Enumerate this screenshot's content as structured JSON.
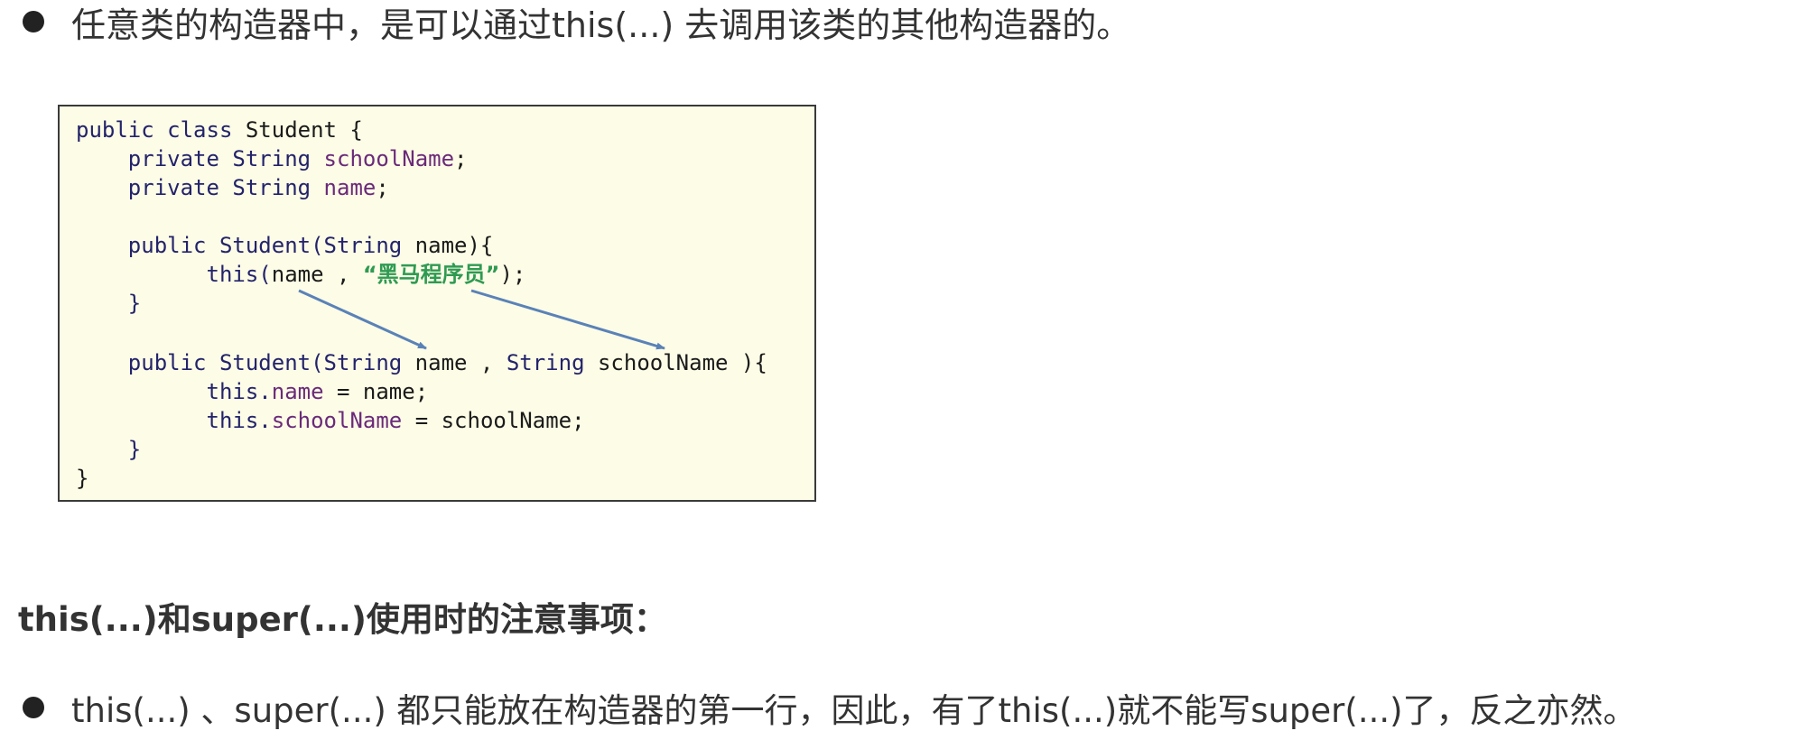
{
  "bullet1": {
    "text": "任意类的构造器中，是可以通过this(...) 去调用该类的其他构造器的。"
  },
  "code": {
    "line1": {
      "kw1": "public class",
      "rest": " Student {"
    },
    "line2": {
      "indent": "    ",
      "kw": "private String",
      "sp": " ",
      "field": "schoolName",
      "end": ";"
    },
    "line3": {
      "indent": "    ",
      "kw": "private String",
      "sp": " ",
      "field": "name",
      "end": ";"
    },
    "line4": {
      "indent": "    ",
      "kw": "public Student(String",
      "rest": " name){"
    },
    "line5": {
      "indent": "          ",
      "kw": "this(",
      "rest": "name , ",
      "str": "“黑马程序员”",
      "end": ");"
    },
    "line6": {
      "indent": "    ",
      "brace": "}"
    },
    "line7": {
      "indent": "    ",
      "kw1": "public Student(String",
      "mid": " name , ",
      "kw2": "String",
      "rest": " schoolName ){"
    },
    "line8": {
      "indent": "          ",
      "kw": "this.",
      "field": "name",
      "rest": " = name;"
    },
    "line9": {
      "indent": "          ",
      "kw": "this.",
      "field": "schoolName",
      "rest": " = schoolName;"
    },
    "line10": {
      "indent": "    ",
      "brace": "}"
    },
    "line11": {
      "brace": "}"
    }
  },
  "section": {
    "heading": "this(...)和super(...)使用时的注意事项："
  },
  "bullet2": {
    "text": "this(...) 、super(...) 都只能放在构造器的第一行，因此，有了this(...)就不能写super(...)了，反之亦然。"
  },
  "colors": {
    "keyword": "#23236b",
    "field": "#6a2a7a",
    "string": "#2e9a52",
    "arrow": "#5a82b8",
    "code_background": "#fdfce6"
  }
}
